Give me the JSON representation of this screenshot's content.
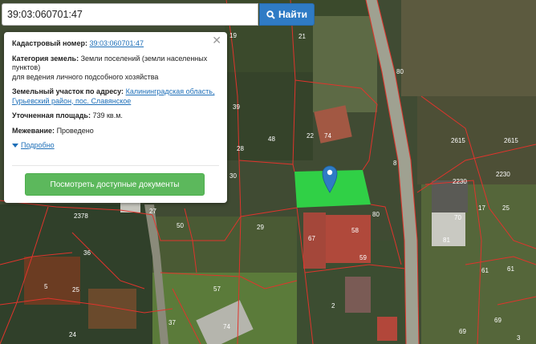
{
  "search": {
    "query": "39:03:060701:47",
    "button_label": "Найти",
    "button_icon": "search-icon"
  },
  "popup": {
    "close_symbol": "✕",
    "cadastral_label": "Кадастровый номер:",
    "cadastral_value": "39:03:060701:47",
    "category_label": "Категория земель:",
    "category_value": "Земли поселений (земли населенных пунктов)",
    "use_value": "для ведения личного подсобного хозяйства",
    "address_label": "Земельный участок по адресу:",
    "address_value": "Калининградская область, Гурьевский район, пос. Славянское",
    "area_label": "Уточненная площадь:",
    "area_value": "739 кв.м.",
    "survey_label": "Межевание:",
    "survey_value": "Проведено",
    "more_label": "Подробно",
    "docs_button_label": "Посмотреть доступные документы"
  },
  "map": {
    "parcel_color": "#2ee84a",
    "boundary_color": "#e0342c",
    "pin_color": "#2f7bc5",
    "labels": [
      "21",
      "19",
      "39",
      "28",
      "80",
      "22",
      "74",
      "48",
      "8",
      "2615",
      "2615",
      "2230",
      "2230",
      "30",
      "2378",
      "27",
      "50",
      "29",
      "67",
      "58",
      "59",
      "70",
      "81",
      "36",
      "5",
      "25",
      "57",
      "2",
      "37",
      "74",
      "24",
      "69",
      "61",
      "61",
      "69",
      "17",
      "25",
      "80",
      "3"
    ]
  }
}
